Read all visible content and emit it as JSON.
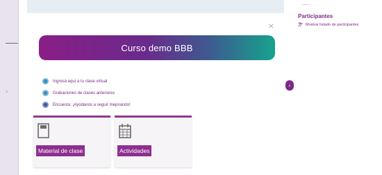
{
  "course": {
    "title": "Curso demo BBB",
    "close_label": "×"
  },
  "links": [
    {
      "label": "Ingresá aquí a tu clase virtual",
      "icon": "video-icon",
      "color": "#2d8fbf"
    },
    {
      "label": "Grabaciones de clases anteriores",
      "icon": "recordings-icon",
      "color": "#3a8fc0"
    },
    {
      "label": "Encuesta: ¡Ayúdanos a seguir mejorando!",
      "icon": "survey-icon",
      "color": "#3b5aa0"
    }
  ],
  "tiles": [
    {
      "label": "Material de clase",
      "icon": "document-icon"
    },
    {
      "label": "Actividades",
      "icon": "calendar-icon"
    }
  ],
  "right_panel": {
    "title": "Participantes",
    "link": "Mostrar listado de participantes",
    "icon": "users-icon"
  },
  "nav": {
    "next_label": "›",
    "rail_arrow": "›"
  },
  "colors": {
    "accent": "#8e2f8f",
    "banner_start": "#8a1e86",
    "banner_end": "#17a38e"
  }
}
